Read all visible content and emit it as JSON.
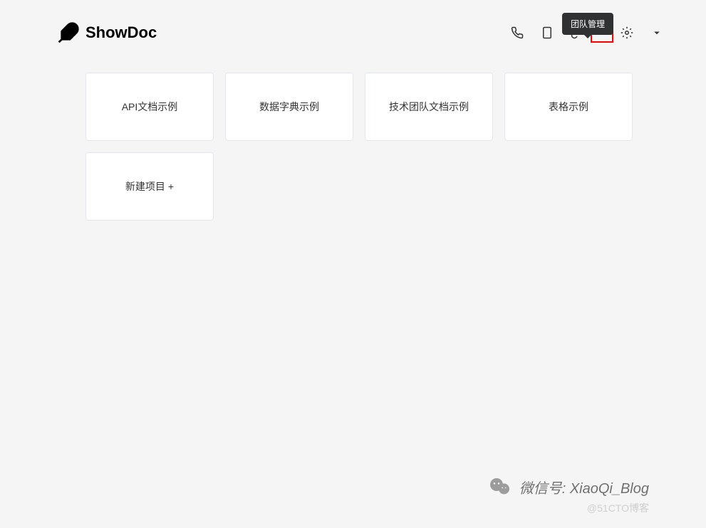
{
  "header": {
    "logo_text": "ShowDoc",
    "tooltip": "团队管理"
  },
  "cards": [
    {
      "label": "API文档示例"
    },
    {
      "label": "数据字典示例"
    },
    {
      "label": "技术团队文档示例"
    },
    {
      "label": "表格示例"
    }
  ],
  "new_project": {
    "label": "新建项目",
    "plus": "+"
  },
  "watermark": {
    "wechat_label": "微信号: XiaoQi_Blog",
    "cto": "@51CTO博客"
  }
}
